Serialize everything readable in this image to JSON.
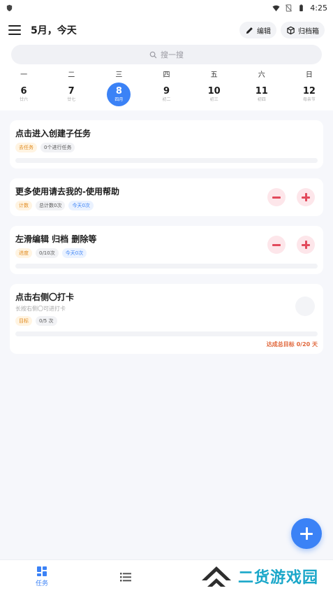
{
  "status_bar": {
    "time": "4:25"
  },
  "header": {
    "title": "5月，今天",
    "edit_label": "编辑",
    "archive_label": "归档箱"
  },
  "search": {
    "placeholder": "搜一搜"
  },
  "week": [
    {
      "weekday": "一",
      "date": "6",
      "lunar": "廿六"
    },
    {
      "weekday": "二",
      "date": "7",
      "lunar": "廿七"
    },
    {
      "weekday": "三",
      "date": "8",
      "lunar": "四月"
    },
    {
      "weekday": "四",
      "date": "9",
      "lunar": "初二"
    },
    {
      "weekday": "五",
      "date": "10",
      "lunar": "初三"
    },
    {
      "weekday": "六",
      "date": "11",
      "lunar": "初四"
    },
    {
      "weekday": "日",
      "date": "12",
      "lunar": "母亲节"
    }
  ],
  "selected_day_index": 2,
  "tasks": [
    {
      "title": "点击进入创建子任务",
      "tags": [
        "去任务",
        "0个进行任务"
      ]
    },
    {
      "title": "更多使用请去我的-使用帮助",
      "tags": [
        "计数",
        "总计数0次",
        "今天0次"
      ]
    },
    {
      "title": "左滑编辑 归档 删除等",
      "tags": [
        "进度",
        "0/10次",
        "今天0次"
      ]
    },
    {
      "title": "点击右侧〇打卡",
      "subtitle": "长按右侧〇可进打卡",
      "tags": [
        "目标",
        "0/5 次"
      ],
      "goal_text": "达成总目标 0/20 天"
    }
  ],
  "bottom_nav": {
    "tasks_label": "任务"
  },
  "watermark": {
    "text": "二货游戏园"
  },
  "colors": {
    "accent": "#3b82f6",
    "danger": "#e24a5c",
    "goal": "#e0663a"
  }
}
